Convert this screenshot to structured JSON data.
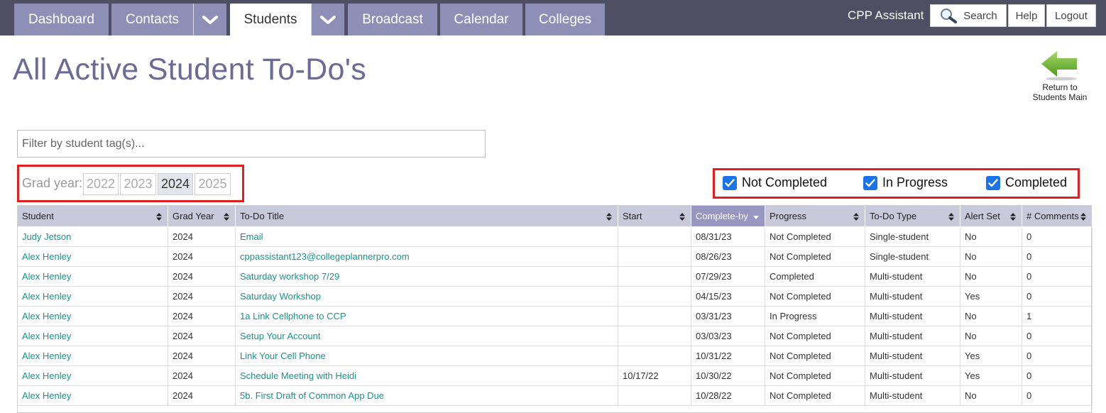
{
  "nav": {
    "tabs": [
      {
        "label": "Dashboard"
      },
      {
        "label": "Contacts"
      },
      {
        "label": "Students"
      },
      {
        "label": "Broadcast"
      },
      {
        "label": "Calendar"
      },
      {
        "label": "Colleges"
      }
    ],
    "user_name": "CPP Assistant",
    "search_label": "Search",
    "help_label": "Help",
    "logout_label": "Logout"
  },
  "page": {
    "title": "All Active Student To-Do's",
    "return_line1": "Return to",
    "return_line2": "Students Main"
  },
  "filter": {
    "placeholder": "Filter by student tag(s)..."
  },
  "grad_year": {
    "label": "Grad year:",
    "years": [
      "2022",
      "2023",
      "2024",
      "2025"
    ],
    "selected": "2024"
  },
  "status_filters": [
    {
      "label": "Not Completed",
      "checked": true
    },
    {
      "label": "In Progress",
      "checked": true
    },
    {
      "label": "Completed",
      "checked": true
    }
  ],
  "table": {
    "columns": [
      "Student",
      "Grad Year",
      "To-Do Title",
      "Start",
      "Complete-by",
      "Progress",
      "To-Do Type",
      "Alert Set",
      "# Comments"
    ],
    "sorted_column": "Complete-by",
    "rows": [
      [
        "Judy Jetson",
        "2024",
        "Email",
        "",
        "08/31/23",
        "Not Completed",
        "Single-student",
        "No",
        "0"
      ],
      [
        "Alex Henley",
        "2024",
        "cppassistant123@collegeplannerpro.com",
        "",
        "08/26/23",
        "Not Completed",
        "Single-student",
        "No",
        "0"
      ],
      [
        "Alex Henley",
        "2024",
        "Saturday workshop 7/29",
        "",
        "07/29/23",
        "Completed",
        "Multi-student",
        "No",
        "0"
      ],
      [
        "Alex Henley",
        "2024",
        "Saturday Workshop",
        "",
        "04/15/23",
        "Not Completed",
        "Multi-student",
        "Yes",
        "0"
      ],
      [
        "Alex Henley",
        "2024",
        "1a Link Cellphone to CCP",
        "",
        "03/31/23",
        "In Progress",
        "Multi-student",
        "No",
        "1"
      ],
      [
        "Alex Henley",
        "2024",
        "Setup Your Account",
        "",
        "03/03/23",
        "Not Completed",
        "Multi-student",
        "No",
        "0"
      ],
      [
        "Alex Henley",
        "2024",
        "Link Your Cell Phone",
        "",
        "10/31/22",
        "Not Completed",
        "Multi-student",
        "Yes",
        "0"
      ],
      [
        "Alex Henley",
        "2024",
        "Schedule Meeting with Heidi",
        "10/17/22",
        "10/30/22",
        "Not Completed",
        "Multi-student",
        "Yes",
        "0"
      ],
      [
        "Alex Henley",
        "2024",
        "5b. First Draft of Common App Due",
        "",
        "10/28/22",
        "Not Completed",
        "Multi-student",
        "No",
        "0"
      ]
    ]
  },
  "colors": {
    "nav_bg": "#4f4f63",
    "tab_bg": "#8e8fb6",
    "title": "#6b6b96",
    "link": "#17948a",
    "highlight_box": "#e02020",
    "checkbox": "#1a73e8"
  }
}
